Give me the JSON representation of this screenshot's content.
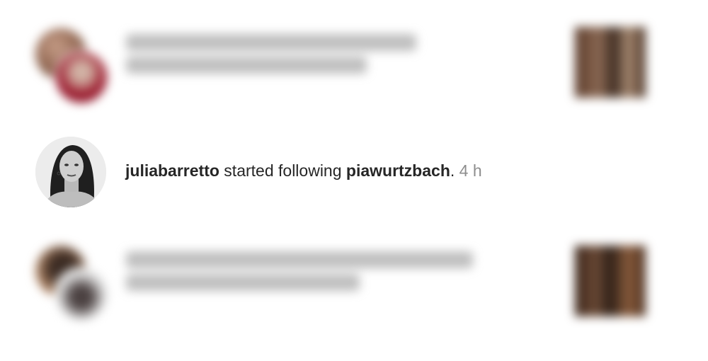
{
  "notification": {
    "actor": "juliabarretto",
    "action": " started following ",
    "target": "piawurtzbach",
    "period": ".",
    "time": "4 h"
  }
}
